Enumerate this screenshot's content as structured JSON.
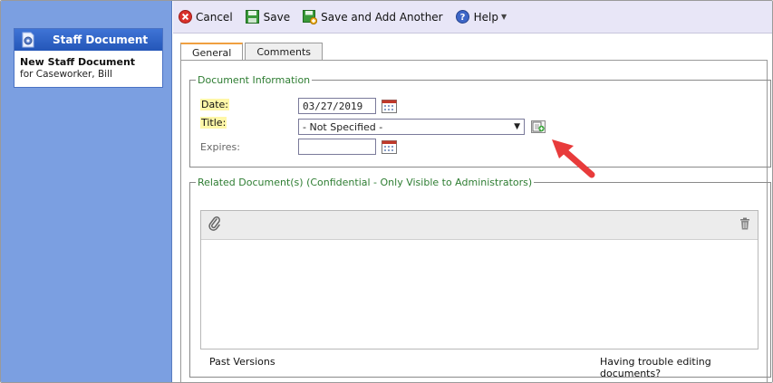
{
  "sidebar": {
    "card_title": "Staff Document",
    "record_title": "New Staff Document",
    "record_subtitle": "for Caseworker, Bill"
  },
  "toolbar": {
    "cancel_label": "Cancel",
    "save_label": "Save",
    "save_add_label": "Save and Add Another",
    "help_label": "Help"
  },
  "tabs": [
    {
      "label": "General",
      "active": true
    },
    {
      "label": "Comments",
      "active": false
    }
  ],
  "document_info": {
    "legend": "Document Information",
    "date_label": "Date:",
    "date_value": "03/27/2019",
    "title_label": "Title:",
    "title_value": "- Not Specified -",
    "expires_label": "Expires:",
    "expires_value": ""
  },
  "related": {
    "legend": "Related Document(s) (Confidential - Only Visible to Administrators)",
    "past_versions": "Past Versions",
    "trouble_link": "Having trouble editing documents?"
  },
  "colors": {
    "sidebar_bg": "#7b9fe1",
    "card_header": "#2f63c8",
    "toolbar_bg": "#e8e6f7",
    "legend_text": "#2e7d32",
    "required_highlight": "#fff7a8",
    "pointer_arrow": "#e83b3b"
  },
  "icons": {
    "cancel": "cancel-icon",
    "save": "save-icon",
    "save_add": "save-add-icon",
    "help": "help-icon",
    "calendar": "calendar-icon",
    "add_title": "add-item-icon",
    "attach": "paperclip-icon",
    "delete": "trash-icon",
    "doc_gear": "document-gear-icon"
  }
}
